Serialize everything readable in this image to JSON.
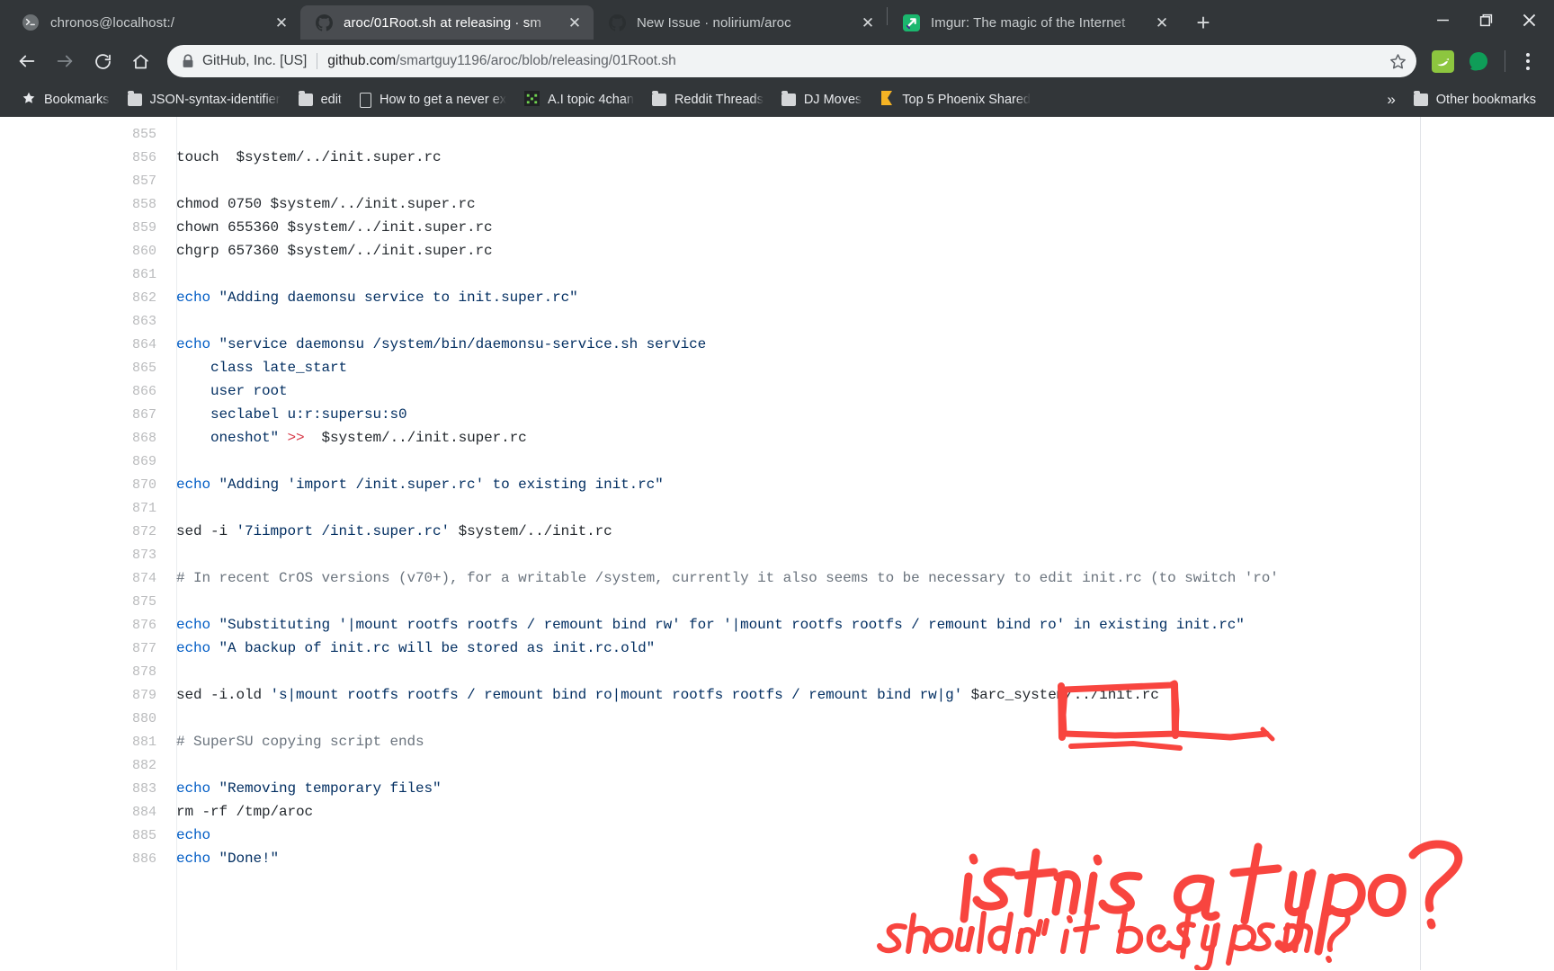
{
  "window": {
    "controls": [
      {
        "name": "minimize",
        "glyph": "—"
      },
      {
        "name": "maximize",
        "glyph": "❐"
      },
      {
        "name": "close",
        "glyph": "✕"
      }
    ]
  },
  "tabs": [
    {
      "title": "chronos@localhost:/",
      "favicon": "terminal-icon",
      "active": false,
      "close": "✕"
    },
    {
      "title": "aroc/01Root.sh at releasing · sm",
      "favicon": "github-icon",
      "active": true,
      "close": "✕"
    },
    {
      "title": "New Issue · nolirium/aroc",
      "favicon": "github-icon",
      "active": false,
      "close": "✕"
    },
    {
      "title": "Imgur: The magic of the Internet",
      "favicon": "imgur-icon",
      "active": false,
      "close": "✕"
    }
  ],
  "newtab_label": "+",
  "toolbar": {
    "back": "back-arrow",
    "forward": "forward-arrow",
    "reload": "reload-arrow",
    "home": "home-icon",
    "security_label": "GitHub, Inc. [US]",
    "url_host": "github.com",
    "url_path": "/smartguy1196/aroc/blob/releasing/01Root.sh",
    "url_full": "github.com/smartguy1196/aroc/blob/releasing/01Root.sh",
    "bookmark_star": "star-icon",
    "extensions": [
      "evernote-extension-icon",
      "green-dot-extension-icon"
    ],
    "menu": "three-dot-menu-icon"
  },
  "bookmarks": {
    "items": [
      {
        "label": "Bookmarks",
        "icon": "star-icon"
      },
      {
        "label": "JSON-syntax-identifier",
        "icon": "folder-icon"
      },
      {
        "label": "edit",
        "icon": "folder-icon"
      },
      {
        "label": "How to get a never ex",
        "icon": "document-icon"
      },
      {
        "label": "A.I topic 4chan",
        "icon": "4chan-icon"
      },
      {
        "label": "Reddit Threads",
        "icon": "folder-icon"
      },
      {
        "label": "DJ Moves",
        "icon": "folder-icon"
      },
      {
        "label": "Top 5 Phoenix Shared",
        "icon": "bookmark-flag-icon"
      }
    ],
    "overflow": "»",
    "other": {
      "label": "Other bookmarks",
      "icon": "folder-icon"
    }
  },
  "code": {
    "lines": [
      {
        "n": "855",
        "tokens": []
      },
      {
        "n": "856",
        "tokens": [
          {
            "t": "touch  $system/../init.super.rc",
            "c": "src"
          }
        ]
      },
      {
        "n": "857",
        "tokens": []
      },
      {
        "n": "858",
        "tokens": [
          {
            "t": "chmod 0750 $system/../init.super.rc",
            "c": "src"
          }
        ]
      },
      {
        "n": "859",
        "tokens": [
          {
            "t": "chown 655360 $system/../init.super.rc",
            "c": "src"
          }
        ]
      },
      {
        "n": "860",
        "tokens": [
          {
            "t": "chgrp 657360 $system/../init.super.rc",
            "c": "src"
          }
        ]
      },
      {
        "n": "861",
        "tokens": []
      },
      {
        "n": "862",
        "tokens": [
          {
            "t": "echo ",
            "c": "k"
          },
          {
            "t": "\"Adding daemonsu service to init.super.rc\"",
            "c": "s"
          }
        ]
      },
      {
        "n": "863",
        "tokens": []
      },
      {
        "n": "864",
        "tokens": [
          {
            "t": "echo ",
            "c": "k"
          },
          {
            "t": "\"service daemonsu /system/bin/daemonsu-service.sh service",
            "c": "s"
          }
        ]
      },
      {
        "n": "865",
        "tokens": [
          {
            "t": "    class late_start",
            "c": "s"
          }
        ]
      },
      {
        "n": "866",
        "tokens": [
          {
            "t": "    user root",
            "c": "s"
          }
        ]
      },
      {
        "n": "867",
        "tokens": [
          {
            "t": "    seclabel u:r:supersu:s0",
            "c": "s"
          }
        ]
      },
      {
        "n": "868",
        "tokens": [
          {
            "t": "    oneshot\" ",
            "c": "s"
          },
          {
            "t": ">>",
            "c": "op"
          },
          {
            "t": "  $system/../init.super.rc",
            "c": "src"
          }
        ]
      },
      {
        "n": "869",
        "tokens": []
      },
      {
        "n": "870",
        "tokens": [
          {
            "t": "echo ",
            "c": "k"
          },
          {
            "t": "\"Adding 'import /init.super.rc' to existing init.rc\"",
            "c": "s"
          }
        ]
      },
      {
        "n": "871",
        "tokens": []
      },
      {
        "n": "872",
        "tokens": [
          {
            "t": "sed -i ",
            "c": "src"
          },
          {
            "t": "'7iimport /init.super.rc'",
            "c": "s"
          },
          {
            "t": " $system/../init.rc",
            "c": "src"
          }
        ]
      },
      {
        "n": "873",
        "tokens": []
      },
      {
        "n": "874",
        "tokens": [
          {
            "t": "# In recent CrOS versions (v70+), for a writable /system, currently it also seems to be necessary to edit init.rc (to switch 'ro'",
            "c": "cm"
          }
        ]
      },
      {
        "n": "875",
        "tokens": []
      },
      {
        "n": "876",
        "tokens": [
          {
            "t": "echo ",
            "c": "k"
          },
          {
            "t": "\"Substituting '|mount rootfs rootfs / remount bind rw' for '|mount rootfs rootfs / remount bind ro' in existing init.rc\"",
            "c": "s"
          }
        ]
      },
      {
        "n": "877",
        "tokens": [
          {
            "t": "echo ",
            "c": "k"
          },
          {
            "t": "\"A backup of init.rc will be stored as init.rc.old\"",
            "c": "s"
          }
        ]
      },
      {
        "n": "878",
        "tokens": []
      },
      {
        "n": "879",
        "tokens": [
          {
            "t": "sed -i.old ",
            "c": "src"
          },
          {
            "t": "'s|mount rootfs rootfs / remount bind ro|mount rootfs rootfs / remount bind rw|g'",
            "c": "s"
          },
          {
            "t": " $arc_system/../init.rc",
            "c": "src"
          }
        ]
      },
      {
        "n": "880",
        "tokens": []
      },
      {
        "n": "881",
        "tokens": [
          {
            "t": "# SuperSU copying script ends",
            "c": "cm"
          }
        ]
      },
      {
        "n": "882",
        "tokens": []
      },
      {
        "n": "883",
        "tokens": [
          {
            "t": "echo ",
            "c": "k"
          },
          {
            "t": "\"Removing temporary files\"",
            "c": "s"
          }
        ]
      },
      {
        "n": "884",
        "tokens": [
          {
            "t": "rm -rf /tmp/aroc",
            "c": "src"
          }
        ]
      },
      {
        "n": "885",
        "tokens": [
          {
            "t": "echo",
            "c": "k"
          }
        ]
      },
      {
        "n": "886",
        "tokens": [
          {
            "t": "echo ",
            "c": "k"
          },
          {
            "t": "\"Done!\"",
            "c": "s"
          }
        ]
      }
    ]
  },
  "annotation": {
    "color": "#f8453f",
    "highlighted_token": "$arc_system",
    "note_line_1": "is this a typo?",
    "note_line_2": "shouldn't it be $system?"
  },
  "colors": {
    "chrome_bg": "#323639",
    "tab_active_bg": "#494c50",
    "omnibox_bg": "#f1f3f4",
    "keyword": "#005cc5",
    "string": "#032f62",
    "operator": "#d73a49",
    "comment": "#6a737d",
    "annotation_red": "#f8453f"
  }
}
